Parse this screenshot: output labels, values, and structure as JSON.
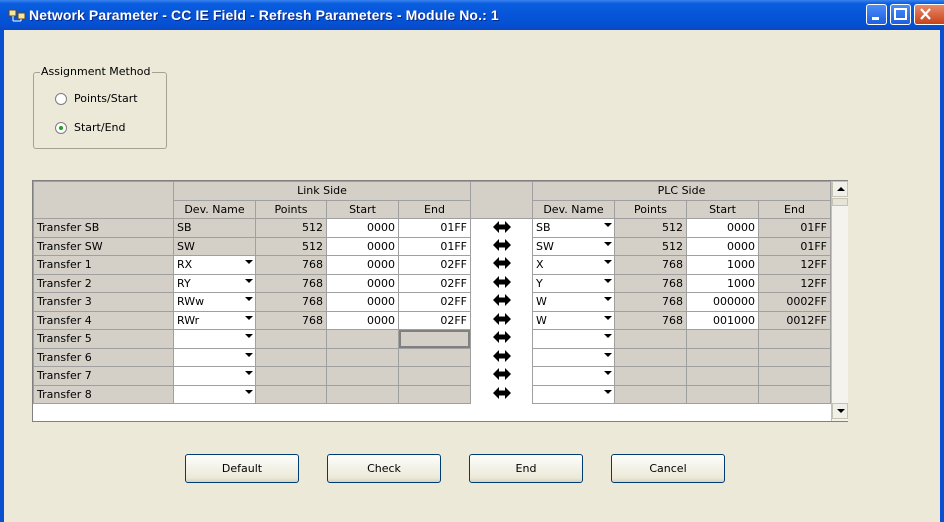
{
  "window": {
    "title": "Network Parameter - CC IE Field - Refresh Parameters - Module No.: 1",
    "controls": [
      "minimize-icon",
      "maximize-icon",
      "close-icon"
    ]
  },
  "assignment": {
    "legend": "Assignment Method",
    "options": [
      {
        "label": "Points/Start",
        "checked": false
      },
      {
        "label": "Start/End",
        "checked": true
      }
    ]
  },
  "table": {
    "link_side": "Link Side",
    "plc_side": "PLC Side",
    "columns": [
      "Dev. Name",
      "Points",
      "Start",
      "End"
    ],
    "rows": [
      {
        "label": "Transfer SB",
        "link": {
          "dev": "SB",
          "points": "512",
          "start": "0000",
          "end": "01FF"
        },
        "plc": {
          "dev": "SB",
          "points": "512",
          "start": "0000",
          "end": "01FF"
        }
      },
      {
        "label": "Transfer SW",
        "link": {
          "dev": "SW",
          "points": "512",
          "start": "0000",
          "end": "01FF"
        },
        "plc": {
          "dev": "SW",
          "points": "512",
          "start": "0000",
          "end": "01FF"
        }
      },
      {
        "label": "Transfer 1",
        "link": {
          "dev": "RX",
          "points": "768",
          "start": "0000",
          "end": "02FF"
        },
        "plc": {
          "dev": "X",
          "points": "768",
          "start": "1000",
          "end": "12FF"
        }
      },
      {
        "label": "Transfer 2",
        "link": {
          "dev": "RY",
          "points": "768",
          "start": "0000",
          "end": "02FF"
        },
        "plc": {
          "dev": "Y",
          "points": "768",
          "start": "1000",
          "end": "12FF"
        }
      },
      {
        "label": "Transfer 3",
        "link": {
          "dev": "RWw",
          "points": "768",
          "start": "0000",
          "end": "02FF"
        },
        "plc": {
          "dev": "W",
          "points": "768",
          "start": "000000",
          "end": "0002FF"
        }
      },
      {
        "label": "Transfer 4",
        "link": {
          "dev": "RWr",
          "points": "768",
          "start": "0000",
          "end": "02FF"
        },
        "plc": {
          "dev": "W",
          "points": "768",
          "start": "001000",
          "end": "0012FF"
        }
      },
      {
        "label": "Transfer 5",
        "link": {
          "dev": "",
          "points": "",
          "start": "",
          "end": ""
        },
        "plc": {
          "dev": "",
          "points": "",
          "start": "",
          "end": ""
        }
      },
      {
        "label": "Transfer 6",
        "link": {
          "dev": "",
          "points": "",
          "start": "",
          "end": ""
        },
        "plc": {
          "dev": "",
          "points": "",
          "start": "",
          "end": ""
        }
      },
      {
        "label": "Transfer 7",
        "link": {
          "dev": "",
          "points": "",
          "start": "",
          "end": ""
        },
        "plc": {
          "dev": "",
          "points": "",
          "start": "",
          "end": ""
        }
      },
      {
        "label": "Transfer 8",
        "link": {
          "dev": "",
          "points": "",
          "start": "",
          "end": ""
        },
        "plc": {
          "dev": "",
          "points": "",
          "start": "",
          "end": ""
        }
      }
    ]
  },
  "buttons": {
    "default": "Default",
    "check": "Check",
    "end": "End",
    "cancel": "Cancel"
  }
}
